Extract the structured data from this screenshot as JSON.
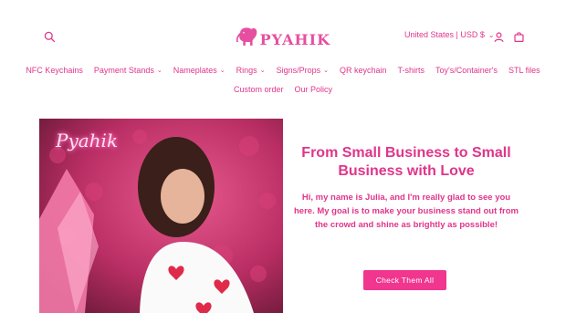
{
  "header": {
    "logo_text": "PYAHIK",
    "locale_label": "United States | USD $",
    "search_icon": "search-icon",
    "account_icon": "account-icon",
    "cart_icon": "cart-icon"
  },
  "nav": {
    "row1": [
      {
        "label": "NFC Keychains",
        "has_dropdown": false
      },
      {
        "label": "Payment Stands",
        "has_dropdown": true
      },
      {
        "label": "Nameplates",
        "has_dropdown": true
      },
      {
        "label": "Rings",
        "has_dropdown": true
      },
      {
        "label": "Signs/Props",
        "has_dropdown": true
      },
      {
        "label": "QR keychain",
        "has_dropdown": false
      },
      {
        "label": "T-shirts",
        "has_dropdown": false
      },
      {
        "label": "Toy's/Container's",
        "has_dropdown": false
      },
      {
        "label": "STL files",
        "has_dropdown": false
      }
    ],
    "row2": [
      {
        "label": "Custom order",
        "has_dropdown": false
      },
      {
        "label": "Our Policy",
        "has_dropdown": false
      }
    ]
  },
  "hero": {
    "title": "From Small Business to Small Business with Love",
    "body": "Hi, my name is Julia, and I'm really glad to see you here. My goal is to make your business stand out from the crowd and shine as brightly as possible!",
    "cta_label": "Check Them All",
    "neon_sign_text": "Pyahik"
  },
  "colors": {
    "brand": "#e0358a",
    "button": "#f0368f"
  }
}
